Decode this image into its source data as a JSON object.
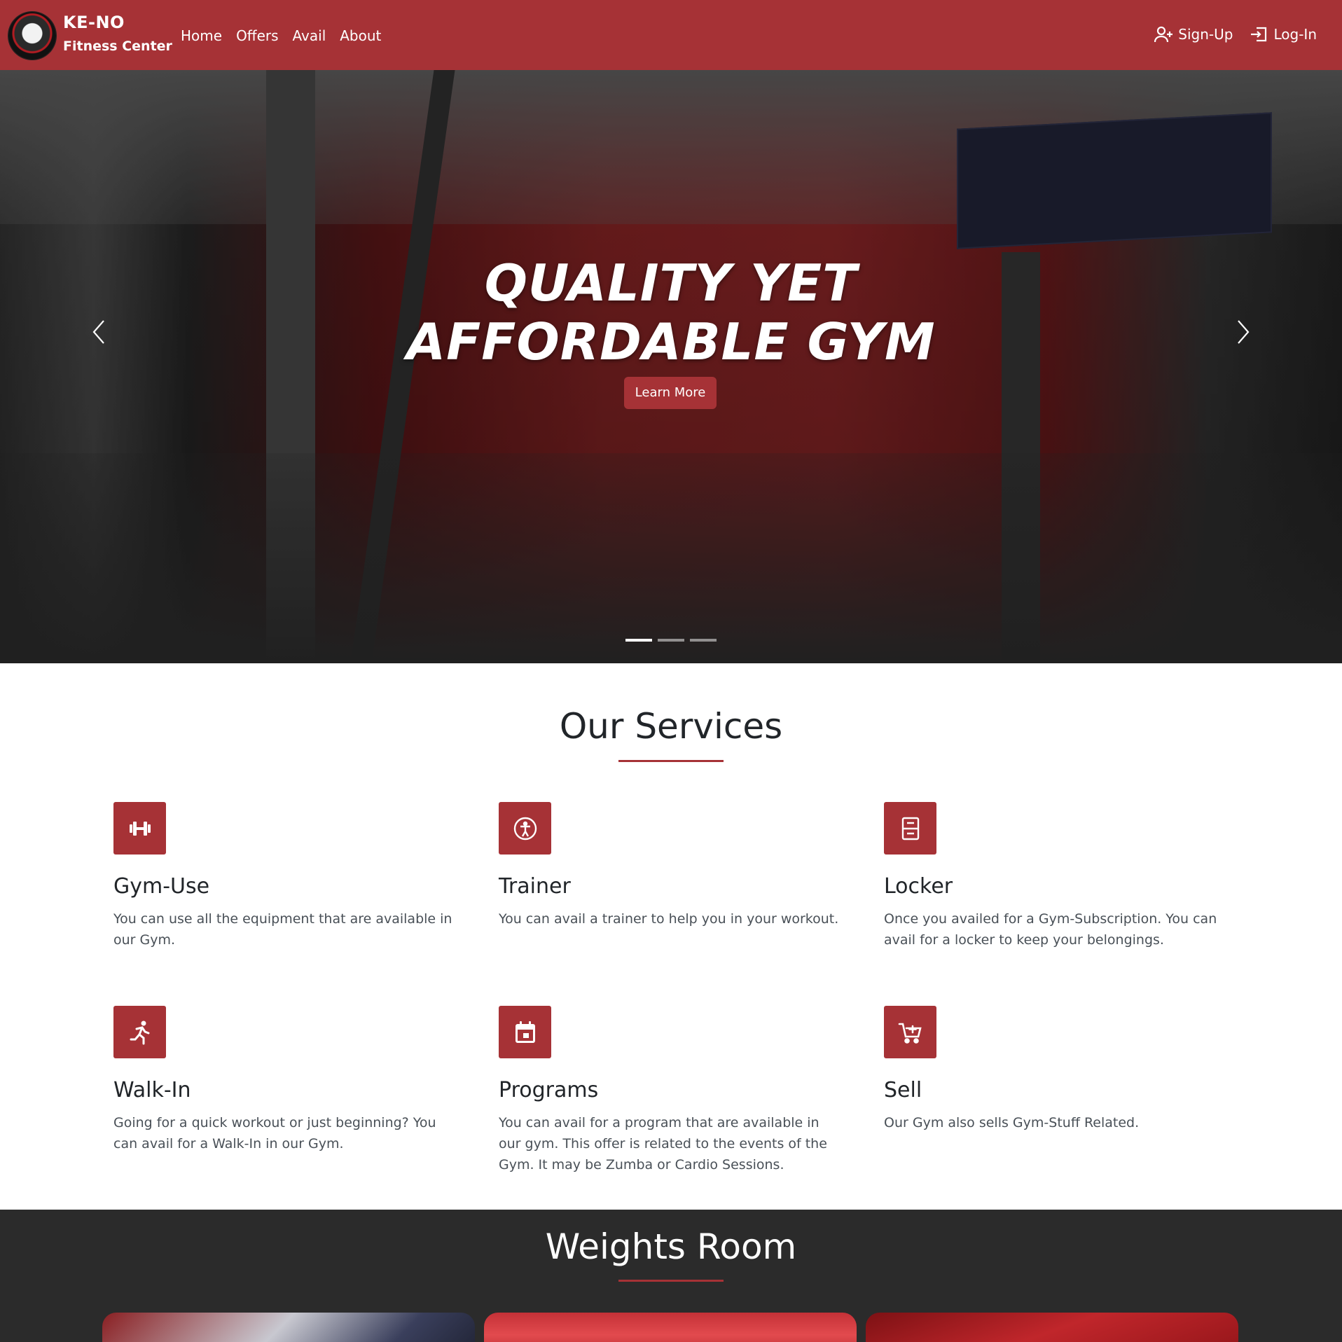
{
  "brand": {
    "title": "KE-NO",
    "subtitle": "Fitness Center",
    "logo_icon": "gym-logo-icon"
  },
  "nav": {
    "links": [
      {
        "label": "Home"
      },
      {
        "label": "Offers"
      },
      {
        "label": "Avail"
      },
      {
        "label": "About"
      }
    ],
    "signup_label": "Sign-Up",
    "login_label": "Log-In"
  },
  "hero": {
    "headline_line1": "QUALITY YET",
    "headline_line2": "AFFORDABLE GYM",
    "button_label": "Learn More",
    "slide_count": 3,
    "active_slide": 1
  },
  "services": {
    "title": "Our Services",
    "items": [
      {
        "name": "Gym-Use",
        "icon": "dumbbell-icon",
        "description": "You can use all the equipment that are available in our Gym."
      },
      {
        "name": "Trainer",
        "icon": "person-circle-icon",
        "description": "You can avail a trainer to help you in your workout."
      },
      {
        "name": "Locker",
        "icon": "locker-icon",
        "description": "Once you availed for a Gym-Subscription. You can avail for a locker to keep your belongings."
      },
      {
        "name": "Walk-In",
        "icon": "running-person-icon",
        "description": "Going for a quick workout or just beginning? You can avail for a Walk-In in our Gym."
      },
      {
        "name": "Programs",
        "icon": "calendar-icon",
        "description": "You can avail for a program that are available in our gym. This offer is related to the events of the Gym. It may be Zumba or Cardio Sessions."
      },
      {
        "name": "Sell",
        "icon": "cart-add-icon",
        "description": "Our Gym also sells Gym-Stuff Related."
      }
    ]
  },
  "weights_room": {
    "title": "Weights Room"
  },
  "colors": {
    "accent": "#a63236",
    "dark_section": "#2b2b2b",
    "text": "#212529",
    "muted": "#495057"
  }
}
